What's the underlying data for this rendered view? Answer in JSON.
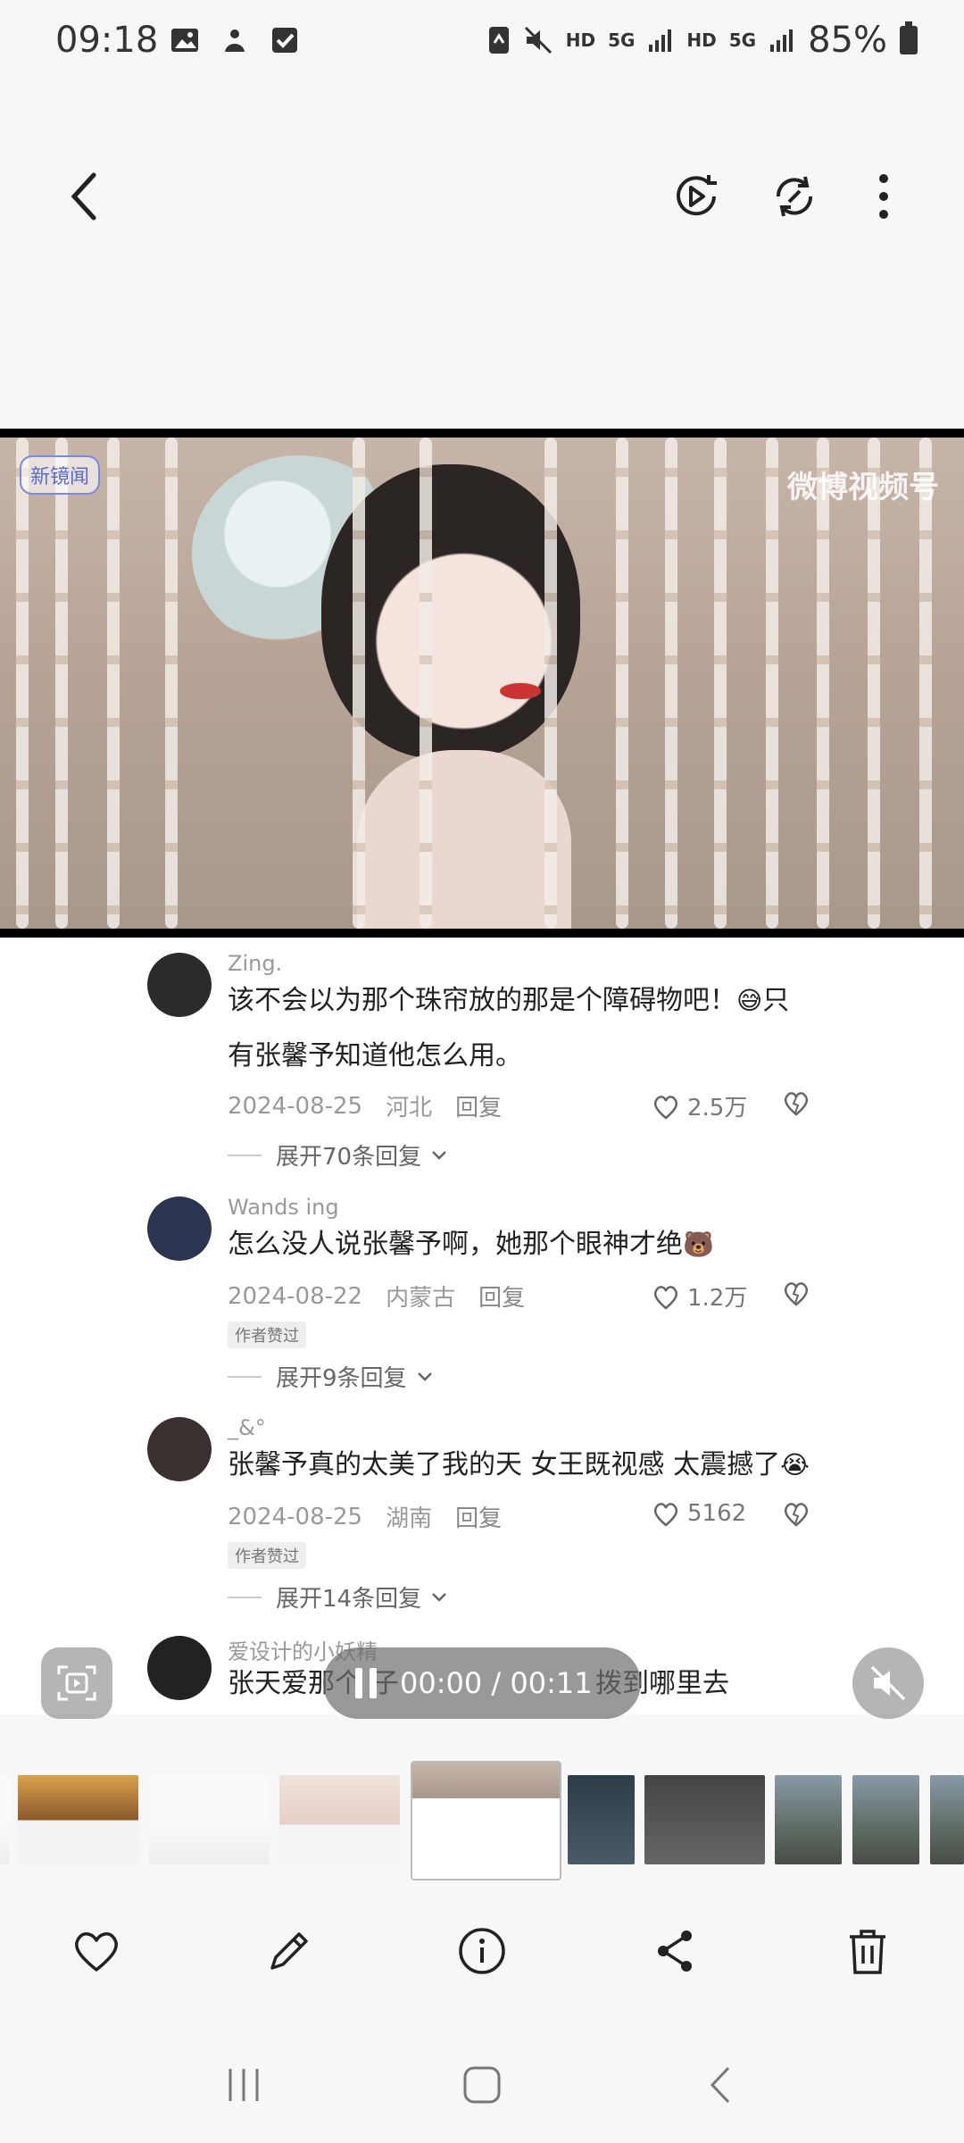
{
  "status_bar": {
    "time": "09:18",
    "battery": "85%",
    "labels": [
      "HD",
      "5G",
      "HD",
      "5G"
    ]
  },
  "video": {
    "watermark_left": "新镜闻",
    "watermark_right": "微博视频号"
  },
  "comments": [
    {
      "username": "Zing.",
      "text_line1": "该不会以为那个珠帘放的那是个障碍物吧！",
      "emoji1": "😅",
      "text_tail": "只",
      "text_line2": "有张馨予知道他怎么用。",
      "date": "2024-08-25",
      "location": "河北",
      "reply": "回复",
      "likes": "2.5万",
      "author_liked": null,
      "expand": "展开70条回复"
    },
    {
      "username": "Wands ing",
      "text_line1": "怎么没人说张馨予啊，她那个眼神才绝",
      "emoji1": "🐻",
      "date": "2024-08-22",
      "location": "内蒙古",
      "reply": "回复",
      "likes": "1.2万",
      "author_liked": "作者赞过",
      "expand": "展开9条回复"
    },
    {
      "username": "_&°",
      "text_line1": "张馨予真的太美了我的天 女王既视感 太震撼了",
      "emoji1": "😭",
      "date": "2024-08-25",
      "location": "湖南",
      "reply": "回复",
      "likes": "5162",
      "author_liked": "作者赞过",
      "expand": "展开14条回复"
    },
    {
      "username": "爱设计的小妖精",
      "text_line1": "张天爱那个",
      "text_line1_tail": "子",
      "text_line1_end": "拨到哪里去"
    }
  ],
  "player": {
    "time": "00:00 / 00:11"
  },
  "actions": [
    "favorite",
    "edit",
    "details",
    "share",
    "delete"
  ],
  "colors": {
    "background": "#f7f7f7",
    "overlay": "#6e6e6e"
  }
}
